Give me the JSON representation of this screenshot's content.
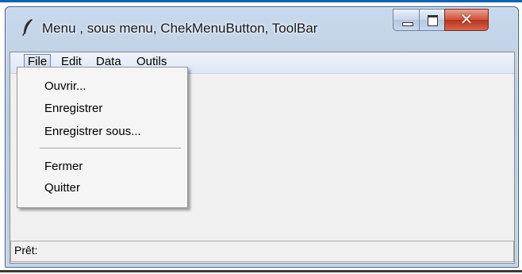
{
  "window": {
    "title": "Menu , sous menu, ChekMenuButton, ToolBar"
  },
  "menubar": {
    "items": [
      "File",
      "Edit",
      "Data",
      "Outils"
    ]
  },
  "file_menu": {
    "group1": [
      "Ouvrir...",
      "Enregistrer",
      "Enregistrer sous..."
    ],
    "group2": [
      "Fermer",
      "Quitter"
    ]
  },
  "status": {
    "text": "Prêt:"
  },
  "icons": {
    "app": "feather-icon",
    "minimize": "minimize-icon",
    "maximize": "maximize-icon",
    "close": "close-icon"
  }
}
